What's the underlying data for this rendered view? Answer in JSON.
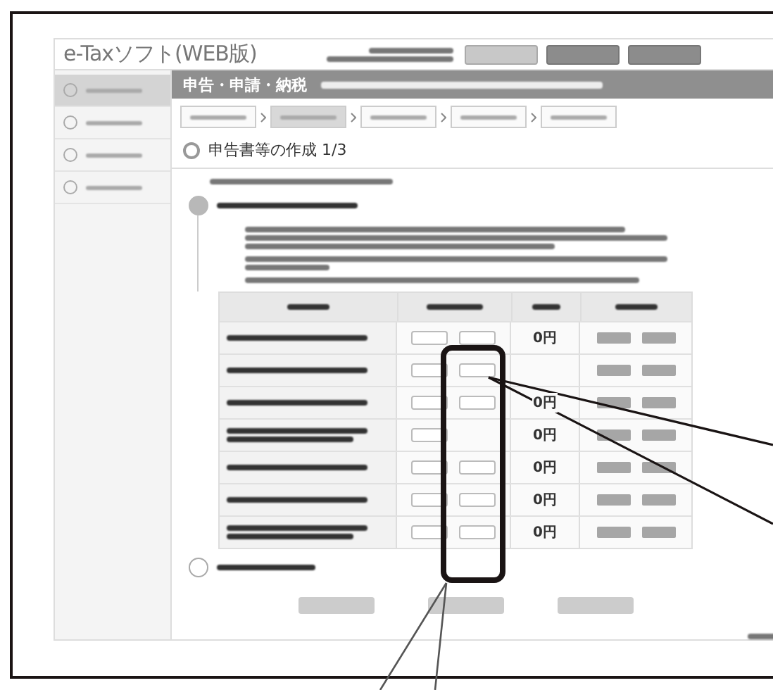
{
  "app_title": "e-Taxソフト(WEB版)",
  "header_buttons": [
    {
      "kind": "light"
    },
    {
      "kind": "dark"
    },
    {
      "kind": "dark"
    }
  ],
  "sidebar": {
    "items": [
      {
        "selected": true
      },
      {
        "selected": false
      },
      {
        "selected": false
      },
      {
        "selected": false
      }
    ]
  },
  "band_title": "申告・申請・納税",
  "steps": [
    {
      "selected": false
    },
    {
      "selected": true
    },
    {
      "selected": false
    },
    {
      "selected": false
    },
    {
      "selected": false
    }
  ],
  "section_title": "申告書等の作成 1/3",
  "table": {
    "rows": [
      {
        "two_line": false,
        "second_edit": true,
        "amount": "0円"
      },
      {
        "two_line": false,
        "second_edit": true
      },
      {
        "two_line": false,
        "second_edit": true,
        "amount": "0円"
      },
      {
        "two_line": true,
        "second_edit": false,
        "amount": "0円"
      },
      {
        "two_line": false,
        "second_edit": true,
        "amount": "0円"
      },
      {
        "two_line": false,
        "second_edit": true,
        "amount": "0円"
      },
      {
        "two_line": true,
        "second_edit": true,
        "amount": "0円"
      }
    ]
  }
}
